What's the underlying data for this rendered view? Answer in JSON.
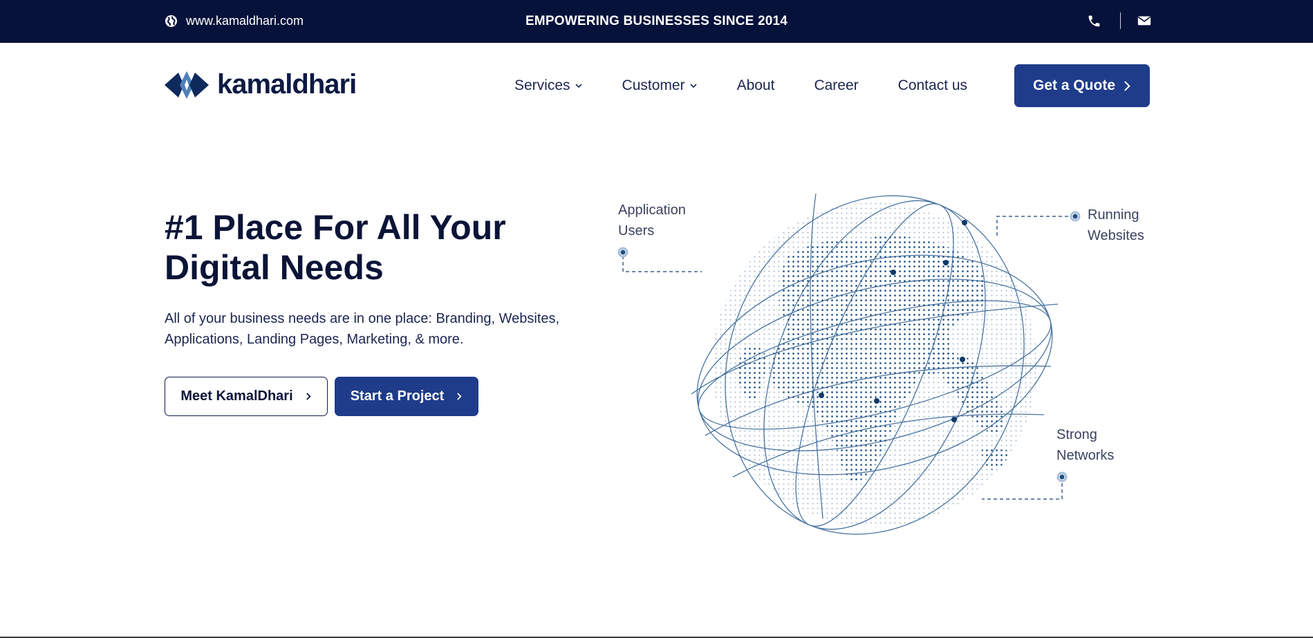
{
  "topbar": {
    "website": "www.kamaldhari.com",
    "tagline": "EMPOWERING BUSINESSES SINCE 2014",
    "icons": [
      "globe-icon",
      "phone-icon",
      "mail-icon"
    ]
  },
  "header": {
    "logo_text": "kamaldhari",
    "nav": [
      {
        "label": "Services",
        "dropdown": true
      },
      {
        "label": "Customer",
        "dropdown": true
      },
      {
        "label": "About",
        "dropdown": false
      },
      {
        "label": "Career",
        "dropdown": false
      },
      {
        "label": "Contact us",
        "dropdown": false
      }
    ],
    "cta_label": "Get a Quote"
  },
  "hero": {
    "title_line1": "#1 Place For All Your",
    "title_line2": "Digital Needs",
    "subtitle_line1": "All of your business needs are in one place: Branding, Websites,",
    "subtitle_line2": "Applications, Landing Pages, Marketing, & more.",
    "primary_button": "Meet KamalDhari",
    "secondary_button": "Start a Project"
  },
  "illustration": {
    "callouts": [
      {
        "line1": "Application",
        "line2": "Users"
      },
      {
        "line1": "Running",
        "line2": "Websites"
      },
      {
        "line1": "Strong",
        "line2": "Networks"
      }
    ]
  },
  "colors": {
    "navy": "#07123a",
    "brand_blue": "#1f3c8a",
    "text": "#0b1437",
    "globe": "#1f4f86"
  }
}
